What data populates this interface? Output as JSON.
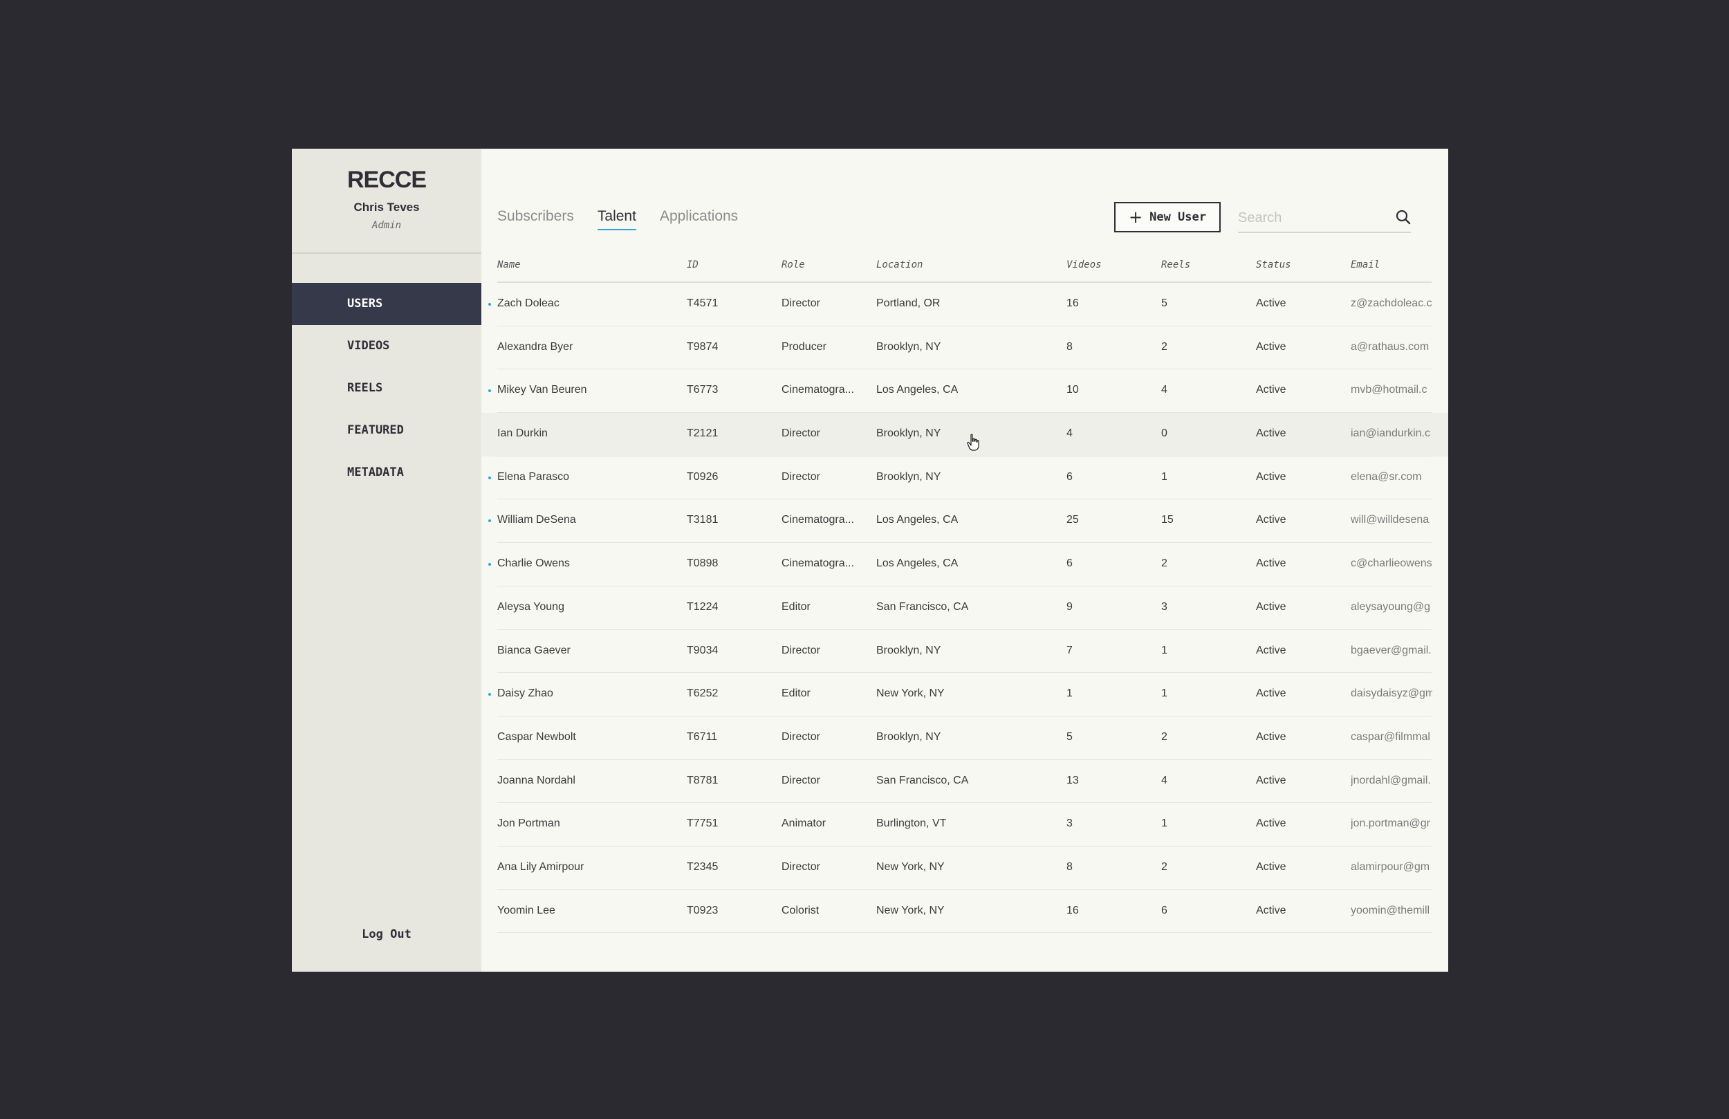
{
  "app": {
    "logo": "RECCE",
    "user": {
      "name": "Chris Teves",
      "role": "Admin"
    }
  },
  "sidebar": {
    "items": [
      {
        "label": "USERS",
        "active": true
      },
      {
        "label": "VIDEOS",
        "active": false
      },
      {
        "label": "REELS",
        "active": false
      },
      {
        "label": "FEATURED",
        "active": false
      },
      {
        "label": "METADATA",
        "active": false
      }
    ],
    "logout_label": "Log Out"
  },
  "tabs": [
    {
      "label": "Subscribers",
      "active": false
    },
    {
      "label": "Talent",
      "active": true
    },
    {
      "label": "Applications",
      "active": false
    }
  ],
  "toolbar": {
    "new_user_label": "New User",
    "new_user_icon": "plus-icon",
    "search_placeholder": "Search",
    "search_icon": "search-icon"
  },
  "colors": {
    "accent": "#2ca6d9",
    "nav_active_bg": "#36394a",
    "sidebar_bg": "#e7e6df",
    "content_bg": "#f8f8f3",
    "backdrop": "#2b2a30"
  },
  "table": {
    "columns": [
      "Name",
      "ID",
      "Role",
      "Location",
      "Videos",
      "Reels",
      "Status",
      "Email"
    ],
    "rows": [
      {
        "flag": true,
        "name": "Zach Doleac",
        "id": "T4571",
        "role": "Director",
        "location": "Portland, OR",
        "videos": "16",
        "reels": "5",
        "status": "Active",
        "email": "z@zachdoleac.c"
      },
      {
        "flag": false,
        "name": "Alexandra Byer",
        "id": "T9874",
        "role": "Producer",
        "location": "Brooklyn, NY",
        "videos": "8",
        "reels": "2",
        "status": "Active",
        "email": "a@rathaus.com"
      },
      {
        "flag": true,
        "name": "Mikey Van Beuren",
        "id": "T6773",
        "role": "Cinematogra...",
        "location": "Los Angeles, CA",
        "videos": "10",
        "reels": "4",
        "status": "Active",
        "email": "mvb@hotmail.c"
      },
      {
        "flag": false,
        "name": "Ian Durkin",
        "id": "T2121",
        "role": "Director",
        "location": "Brooklyn, NY",
        "videos": "4",
        "reels": "0",
        "status": "Active",
        "email": "ian@iandurkin.c",
        "hover": true
      },
      {
        "flag": true,
        "name": "Elena Parasco",
        "id": "T0926",
        "role": "Director",
        "location": "Brooklyn, NY",
        "videos": "6",
        "reels": "1",
        "status": "Active",
        "email": "elena@sr.com"
      },
      {
        "flag": true,
        "name": "William DeSena",
        "id": "T3181",
        "role": "Cinematogra...",
        "location": "Los Angeles, CA",
        "videos": "25",
        "reels": "15",
        "status": "Active",
        "email": "will@willdesena"
      },
      {
        "flag": true,
        "name": "Charlie Owens",
        "id": "T0898",
        "role": "Cinematogra...",
        "location": "Los Angeles, CA",
        "videos": "6",
        "reels": "2",
        "status": "Active",
        "email": "c@charlieowens"
      },
      {
        "flag": false,
        "name": "Aleysa Young",
        "id": "T1224",
        "role": "Editor",
        "location": "San Francisco, CA",
        "videos": "9",
        "reels": "3",
        "status": "Active",
        "email": "aleysayoung@g"
      },
      {
        "flag": false,
        "name": "Bianca Gaever",
        "id": "T9034",
        "role": "Director",
        "location": "Brooklyn, NY",
        "videos": "7",
        "reels": "1",
        "status": "Active",
        "email": "bgaever@gmail."
      },
      {
        "flag": true,
        "name": "Daisy Zhao",
        "id": "T6252",
        "role": "Editor",
        "location": "New York, NY",
        "videos": "1",
        "reels": "1",
        "status": "Active",
        "email": "daisydaisyz@gm"
      },
      {
        "flag": false,
        "name": "Caspar Newbolt",
        "id": "T6711",
        "role": "Director",
        "location": "Brooklyn, NY",
        "videos": "5",
        "reels": "2",
        "status": "Active",
        "email": "caspar@filmmal"
      },
      {
        "flag": false,
        "name": "Joanna Nordahl",
        "id": "T8781",
        "role": "Director",
        "location": "San Francisco, CA",
        "videos": "13",
        "reels": "4",
        "status": "Active",
        "email": "jnordahl@gmail."
      },
      {
        "flag": false,
        "name": "Jon Portman",
        "id": "T7751",
        "role": "Animator",
        "location": "Burlington, VT",
        "videos": "3",
        "reels": "1",
        "status": "Active",
        "email": "jon.portman@gr"
      },
      {
        "flag": false,
        "name": "Ana Lily Amirpour",
        "id": "T2345",
        "role": "Director",
        "location": "New York, NY",
        "videos": "8",
        "reels": "2",
        "status": "Active",
        "email": "alamirpour@gm"
      },
      {
        "flag": false,
        "name": "Yoomin Lee",
        "id": "T0923",
        "role": "Colorist",
        "location": "New York, NY",
        "videos": "16",
        "reels": "6",
        "status": "Active",
        "email": "yoomin@themill"
      }
    ]
  }
}
